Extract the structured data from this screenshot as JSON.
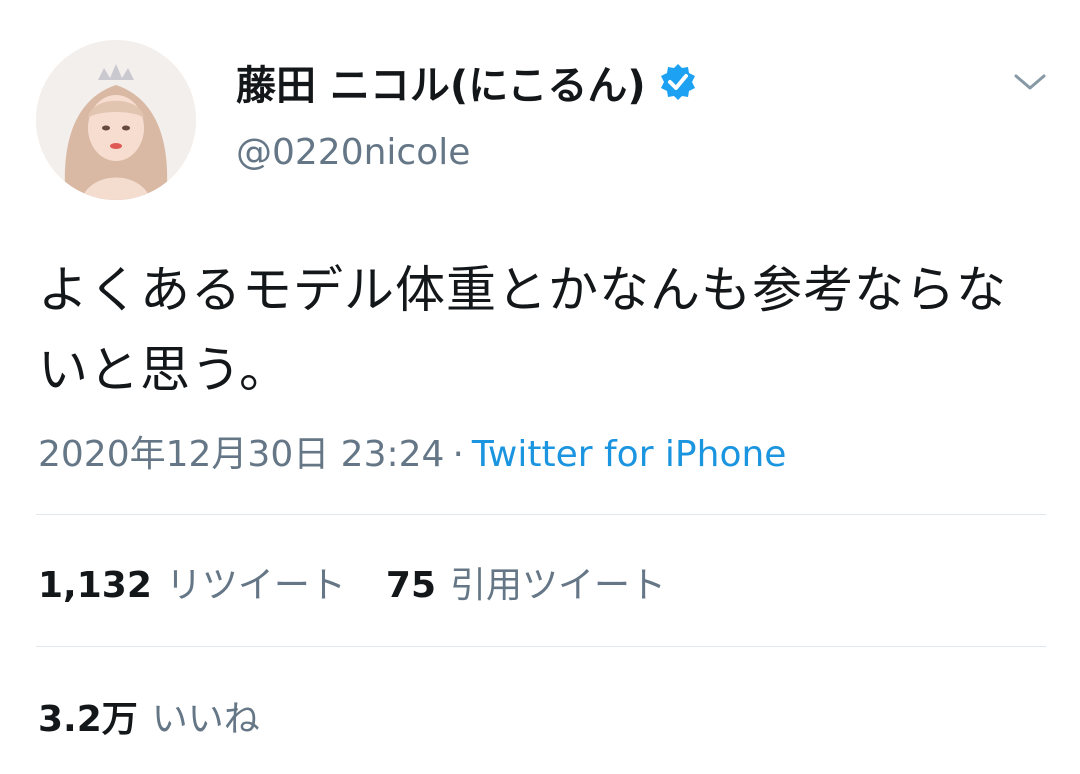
{
  "user": {
    "display_name": "藤田 ニコル(にこるん)",
    "handle": "@0220nicole",
    "verified": true
  },
  "tweet": {
    "text": "よくあるモデル体重とかなんも参考ならないと思う。",
    "timestamp": "2020年12月30日 23:24",
    "separator": "·",
    "source": "Twitter for iPhone"
  },
  "stats": {
    "retweets_count": "1,132",
    "retweets_label": "リツイート",
    "quotes_count": "75",
    "quotes_label": "引用ツイート",
    "likes_count": "3.2万",
    "likes_label": "いいね"
  },
  "icons": {
    "verified": "verified-badge-icon",
    "menu": "chevron-down-icon"
  },
  "colors": {
    "text": "#14171a",
    "secondary": "#657786",
    "link": "#1b95e0",
    "verified": "#1da1f2",
    "divider": "#e1e8ed"
  }
}
